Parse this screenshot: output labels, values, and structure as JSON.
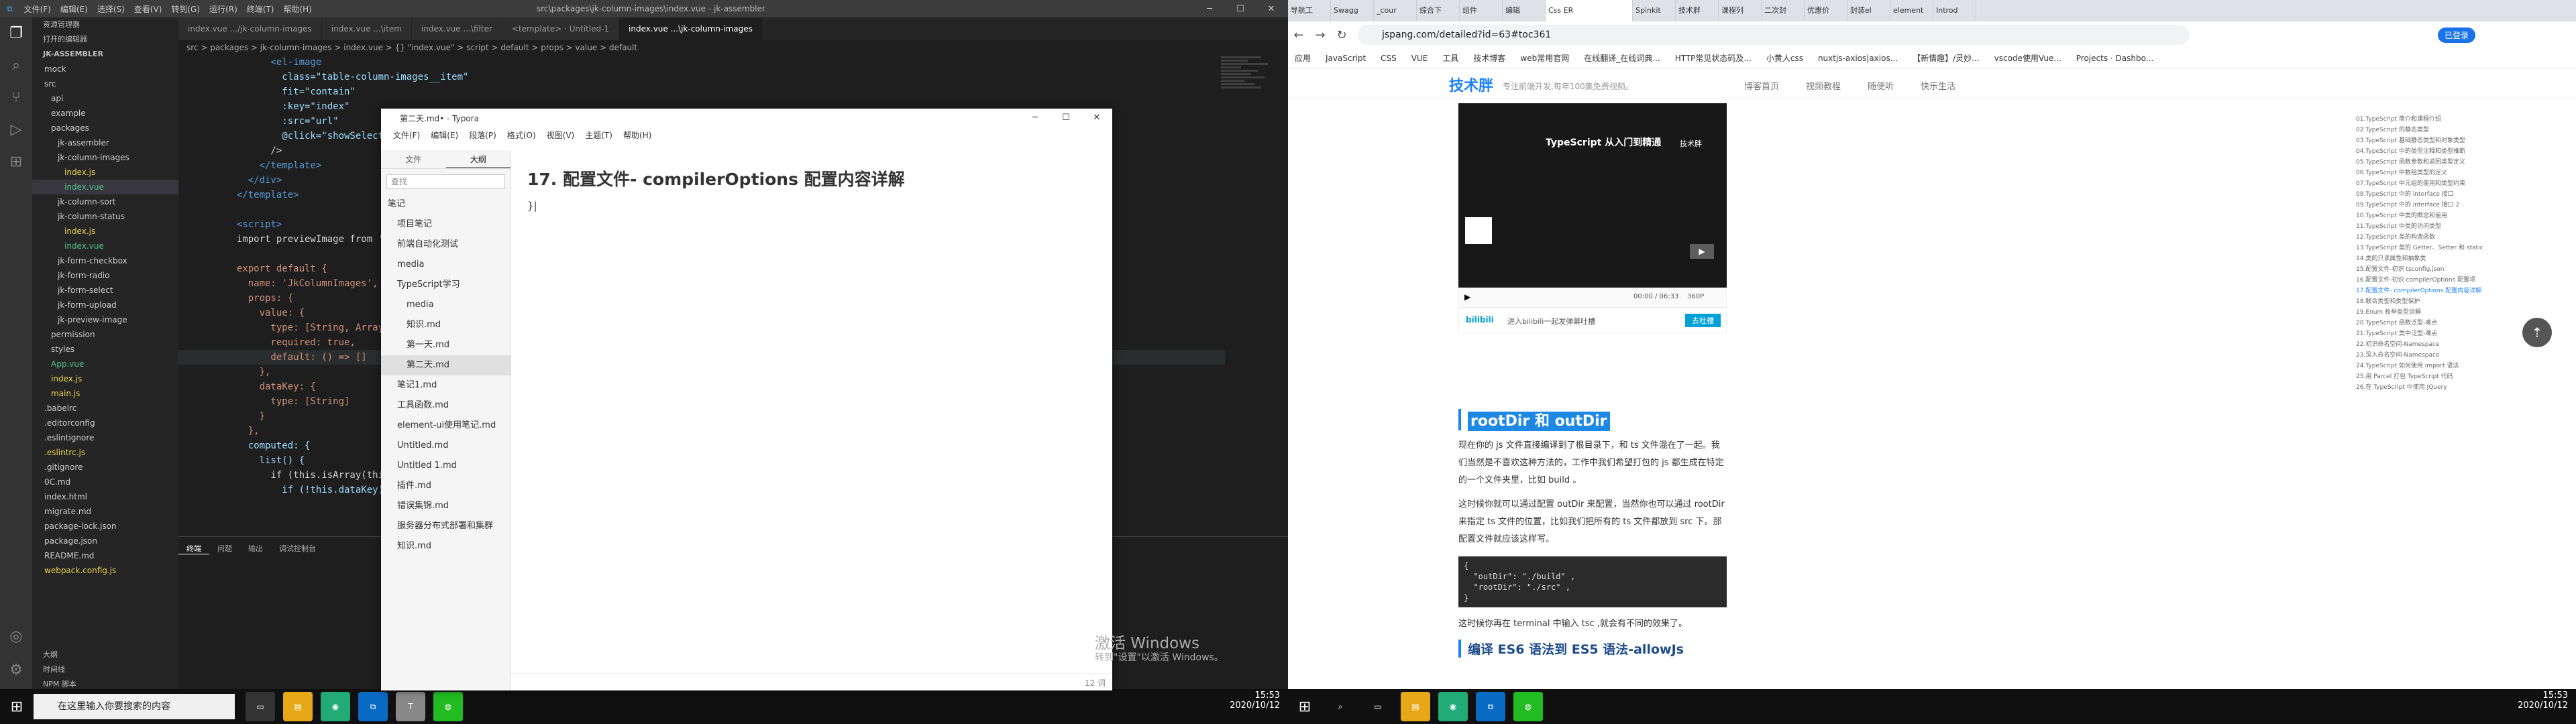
{
  "vscode": {
    "menu": [
      "文件(F)",
      "编辑(E)",
      "选择(S)",
      "查看(V)",
      "转到(G)",
      "运行(R)",
      "终端(T)",
      "帮助(H)"
    ],
    "open_tabs": [
      "index.vue .../jk-column-images",
      "index.vue ...\\item",
      "index.vue ...\\filter",
      "<template> · Untitled-1",
      "index.vue ...\\jk-column-images"
    ],
    "window_title": "src\\packages\\jk-column-images\\index.vue - jk-assembler",
    "breadcrumb": "src > packages > jk-column-images > index.vue > {} \"index.vue\" > script > default > props > value > default",
    "explorer_header": "资源管理器",
    "open_editors": "打开的编辑器",
    "project": "JK-ASSEMBLER",
    "tree": [
      "mock",
      "src",
      "api",
      "example",
      "packages",
      "jk-assembler",
      "jk-column-images",
      "index.js",
      "index.vue",
      "jk-column-sort",
      "jk-column-status",
      "index.js",
      "index.vue",
      "jk-form-checkbox",
      "jk-form-radio",
      "jk-form-select",
      "jk-form-upload",
      "jk-preview-image",
      "permission",
      "styles",
      "App.vue",
      "index.js",
      "main.js",
      ".babelrc",
      ".editorconfig",
      ".eslintignore",
      ".eslintrc.js",
      ".gitignore",
      "0C.md",
      "index.html",
      "migrate.md",
      "package-lock.json",
      "package.json",
      "README.md",
      "webpack.config.js"
    ],
    "code": [
      {
        "n": "",
        "t": "        <el-image"
      },
      {
        "n": "",
        "t": "          class=\"table-column-images__item\""
      },
      {
        "n": "",
        "t": "          fit=\"contain\""
      },
      {
        "n": "",
        "t": "          :key=\"index\""
      },
      {
        "n": "",
        "t": "          :src=\"url\""
      },
      {
        "n": "",
        "t": "          @click=\"showSelected"
      },
      {
        "n": "",
        "t": "        />"
      },
      {
        "n": "",
        "t": "      </template>"
      },
      {
        "n": "",
        "t": "    </div>"
      },
      {
        "n": "",
        "t": "  </template>"
      },
      {
        "n": "",
        "t": ""
      },
      {
        "n": "",
        "t": "  <script>"
      },
      {
        "n": "",
        "t": "  import previewImage from '..."
      },
      {
        "n": "",
        "t": ""
      },
      {
        "n": "",
        "t": "  export default {"
      },
      {
        "n": "",
        "t": "    name: 'JkColumnImages',"
      },
      {
        "n": "",
        "t": "    props: {"
      },
      {
        "n": "",
        "t": "      value: {"
      },
      {
        "n": "",
        "t": "        type: [String, Array],"
      },
      {
        "n": "",
        "t": "        required: true,"
      },
      {
        "n": "",
        "t": "        default: () => []"
      },
      {
        "n": "",
        "t": "      },"
      },
      {
        "n": "",
        "t": "      dataKey: {"
      },
      {
        "n": "",
        "t": "        type: [String]"
      },
      {
        "n": "",
        "t": "      }"
      },
      {
        "n": "",
        "t": "    },"
      },
      {
        "n": "",
        "t": "    computed: {"
      },
      {
        "n": "",
        "t": "      list() {"
      },
      {
        "n": "",
        "t": "        if (this.isArray(this.v"
      },
      {
        "n": "",
        "t": "          if (!this.dataKey) {"
      }
    ],
    "terminal_tabs": [
      "终端",
      "问题",
      "输出",
      "调试控制台"
    ],
    "outline": [
      "大纲",
      "时间线",
      "NPM 脚本"
    ]
  },
  "typora": {
    "title": "第二天.md• - Typora",
    "menu": [
      "文件(F)",
      "编辑(E)",
      "段落(P)",
      "格式(O)",
      "视图(V)",
      "主题(T)",
      "帮助(H)"
    ],
    "side_tabs": [
      "文件",
      "大纲"
    ],
    "search_placeholder": "查找",
    "files": [
      "笔记",
      "项目笔记",
      "前端自动化测试",
      "media",
      "TypeScript学习",
      "media",
      "知识.md",
      "第一天.md",
      "第二天.md",
      "笔记1.md",
      "工具函数.md",
      "element-ui使用笔记.md",
      "Untitled.md",
      "Untitled 1.md",
      "插件.md",
      "错误集锦.md",
      "服务器分布式部署和集群",
      "知识.md"
    ],
    "heading": "17. 配置文件- compilerOptions 配置内容详解",
    "cursor": "}|",
    "word_count": "12 词"
  },
  "watermark": {
    "line1": "激活 Windows",
    "line2": "转到\"设置\"以激活 Windows。"
  },
  "taskbar": {
    "search": "在这里输入你要搜索的内容",
    "time": "15:53",
    "date": "2020/10/12",
    "time2": "15:53",
    "date2": "2020/10/12"
  },
  "chrome": {
    "tabs": [
      "导航工",
      "Swagg",
      "_cour",
      "综合下",
      "组件",
      "编辑",
      "Css ER",
      "Spinkit",
      "技术胖",
      "课程列",
      "二次封",
      "优惠价",
      "封装el",
      "element",
      "Introd"
    ],
    "url": "jspang.com/detailed?id=63#toc361",
    "bookmarks": [
      "应用",
      "JavaScript",
      "CSS",
      "VUE",
      "工具",
      "技术博客",
      "web常用官网",
      "在线翻译_在线词典...",
      "HTTP常见状态码及...",
      "小黄人css",
      "nuxtjs-axios|axios...",
      "【新情趣】/灵妙...",
      "vscode使用Vue...",
      "Projects · Dashbo..."
    ],
    "site_logo": "技术胖",
    "slogan": "专注前端开发,每年100集免费视频。",
    "nav": [
      "博客首页",
      "视频教程",
      "随便听",
      "快乐生活"
    ],
    "video_title": "TypeScript 从入门到精通",
    "video_tag": "技术胖",
    "video_time": "00:00 / 06:33",
    "video_speed": "360P",
    "danmaku_placeholder": "进入bilibili一起发弹幕吐槽",
    "danmaku_btn": "去吐槽",
    "section1": "rootDir 和 outDir",
    "p1": "现在你的 js 文件直接编译到了根目录下，和 ts 文件混在了一起。我们当然是不喜欢这种方法的，工作中我们希望打包的 js 都生成在特定的一个文件夹里，比如 build 。",
    "p2": "这时候你就可以通过配置 outDir 来配置，当然你也可以通过 rootDir 来指定 ts 文件的位置，比如我们把所有的 ts 文件都放到 src 下。那配置文件就应该这样写。",
    "code": "{\n  \"outDir\": \"./build\" ,\n  \"rootDir\": \"./src\" ,\n}",
    "p3": "这时候你再在 terminal 中输入 tsc ,就会有不同的效果了。",
    "section2": "编译 ES6 语法到 ES5 语法-allowJs",
    "toc": [
      "01.TypeScript 简介和课程介绍",
      "02.TypeScript 的静态类型",
      "03.TypeScript 基础静态类型和对象类型",
      "04.TypeScript 中的类型注释和类型推断",
      "05.TypeScript 函数参数和返回类型定义",
      "06.TypeScript 中数组类型的定义",
      "07.TypeScript 中元组的使用和类型约束",
      "08.TypeScript 中的 interface 接口",
      "09.TypeScript 中的 interface 接口 2",
      "10.TypeScript 中类的概念和使用",
      "11.TypeScript 中类的访问类型",
      "12.TypeScript 类的构造函数",
      "13.TypeScript 类的 Getter、Setter 和 static",
      "14.类的只读属性和抽象类",
      "15.配置文件-初识 tsconfig.json",
      "16.配置文件-初识 compilerOptions 配置项",
      "17.配置文件- compilerOptions 配置内容详解",
      "18.联合类型和类型保护",
      "19.Enum 枚举类型讲解",
      "20.TypeScript 函数泛型-难点",
      "21.TypeScript 类中泛型-难点",
      "22.初识命名空间-Namespace",
      "23.深入命名空间-Namespace",
      "24.TypeScript 如何使用 import 语法",
      "25.用 Parcel 打包 TypeScript 代码",
      "26.在 TypeScript 中使用 JQuery"
    ],
    "login": "已登录"
  }
}
